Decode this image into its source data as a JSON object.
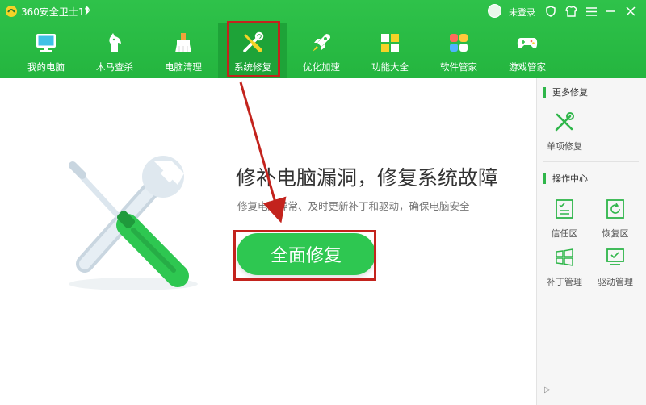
{
  "window": {
    "title": "360安全卫士12",
    "login_text": "未登录"
  },
  "nav": {
    "items": [
      {
        "label": "我的电脑"
      },
      {
        "label": "木马查杀"
      },
      {
        "label": "电脑清理"
      },
      {
        "label": "系统修复"
      },
      {
        "label": "优化加速"
      },
      {
        "label": "功能大全"
      },
      {
        "label": "软件管家"
      },
      {
        "label": "游戏管家"
      }
    ],
    "active_index": 3
  },
  "main": {
    "title": "修补电脑漏洞，修复系统故障",
    "subtitle": "修复电脑异常、及时更新补丁和驱动，确保电脑安全",
    "repair_button": "全面修复"
  },
  "side": {
    "more_repair": {
      "title": "更多修复",
      "items": [
        {
          "label": "单项修复"
        }
      ]
    },
    "ops_center": {
      "title": "操作中心",
      "items": [
        {
          "label": "信任区"
        },
        {
          "label": "恢复区"
        },
        {
          "label": "补丁管理"
        },
        {
          "label": "驱动管理"
        }
      ]
    }
  },
  "colors": {
    "brand_green": "#2fc24a",
    "button_green": "#2ec751",
    "annotation_red": "#c3231d"
  }
}
